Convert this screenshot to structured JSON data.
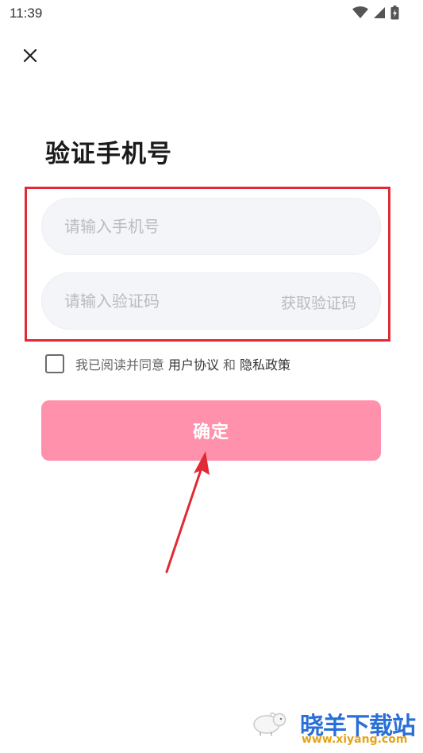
{
  "status_bar": {
    "time": "11:39"
  },
  "page": {
    "title": "验证手机号"
  },
  "form": {
    "phone_placeholder": "请输入手机号",
    "code_placeholder": "请输入验证码",
    "get_code_label": "获取验证码"
  },
  "agreement": {
    "prefix": "我已阅读并同意",
    "user_agreement": "用户协议",
    "conjunction": "和",
    "privacy_policy": "隐私政策"
  },
  "confirm_label": "确定",
  "colors": {
    "confirm_button": "#ff91ad",
    "highlight_border": "#e02a35",
    "input_background": "#f4f5f8"
  },
  "watermark": {
    "brand": "晓羊下载站",
    "url": "www.xiyang.com"
  }
}
